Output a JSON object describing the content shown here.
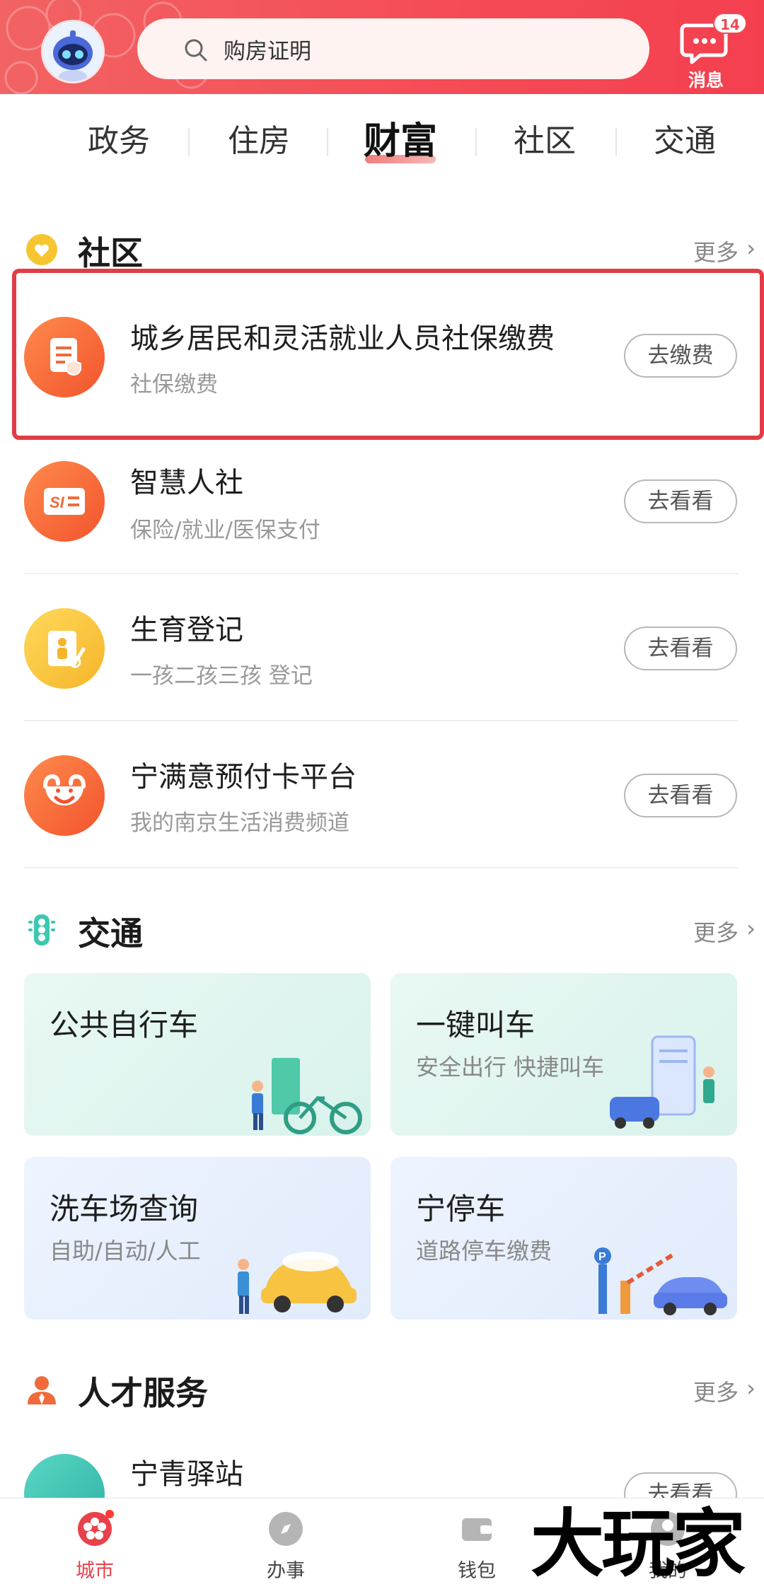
{
  "header": {
    "search_placeholder": "购房证明",
    "message_label": "消息",
    "message_badge": "14"
  },
  "tabs": [
    {
      "label": "政务",
      "active": false
    },
    {
      "label": "住房",
      "active": false
    },
    {
      "label": "财富",
      "active": true
    },
    {
      "label": "社区",
      "active": false
    },
    {
      "label": "交通",
      "active": false
    }
  ],
  "community": {
    "title": "社区",
    "more": "更多",
    "items": [
      {
        "title": "城乡居民和灵活就业人员社保缴费",
        "subtitle": "社保缴费",
        "button": "去缴费",
        "icon": "document-shield-icon",
        "highlighted": true
      },
      {
        "title": "智慧人社",
        "subtitle": "保险/就业/医保支付",
        "button": "去看看",
        "icon": "si-card-icon"
      },
      {
        "title": "生育登记",
        "subtitle": "一孩二孩三孩 登记",
        "button": "去看看",
        "icon": "birth-register-icon"
      },
      {
        "title": "宁满意预付卡平台",
        "subtitle": "我的南京生活消费频道",
        "button": "去看看",
        "icon": "smile-icon"
      }
    ]
  },
  "traffic": {
    "title": "交通",
    "more": "更多",
    "cards": [
      {
        "title": "公共自行车",
        "subtitle": ""
      },
      {
        "title": "一键叫车",
        "subtitle": "安全出行 快捷叫车"
      },
      {
        "title": "洗车场查询",
        "subtitle": "自助/自动/人工"
      },
      {
        "title": "宁停车",
        "subtitle": "道路停车缴费"
      }
    ]
  },
  "talent": {
    "title": "人才服务",
    "more": "更多",
    "items": [
      {
        "title": "宁青驿站",
        "button": "去看看"
      }
    ]
  },
  "bottom_nav": [
    {
      "label": "城市",
      "active": true
    },
    {
      "label": "办事",
      "active": false
    },
    {
      "label": "钱包",
      "active": false
    },
    {
      "label": "我的",
      "active": false
    }
  ],
  "watermark": "大玩家",
  "colors": {
    "accent": "#f14a53",
    "highlight_border": "#e23c44"
  }
}
